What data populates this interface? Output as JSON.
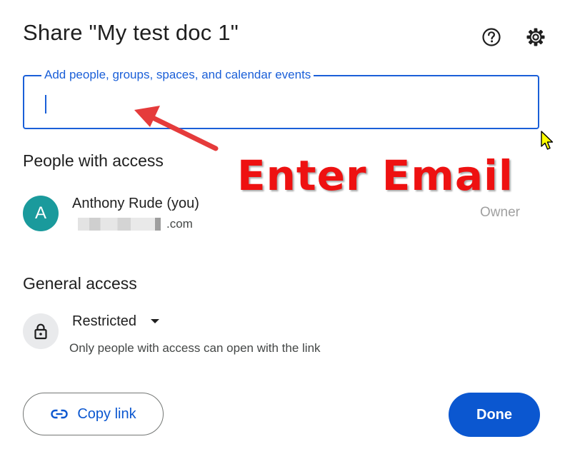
{
  "dialog": {
    "title": "Share \"My test doc 1\"",
    "help_icon": "help-circle-icon",
    "settings_icon": "gear-icon"
  },
  "add_people": {
    "label": "Add people, groups, spaces, and calendar events",
    "value": ""
  },
  "people_with_access": {
    "heading": "People with access",
    "people": [
      {
        "avatar_letter": "A",
        "avatar_color": "#1a9a9c",
        "name": "Anthony Rude (you)",
        "email_visible_suffix": ".com",
        "role": "Owner"
      }
    ]
  },
  "general_access": {
    "heading": "General access",
    "icon": "lock-icon",
    "selected": "Restricted",
    "description": "Only people with access can open with the link"
  },
  "buttons": {
    "copy_link": "Copy link",
    "copy_link_icon": "link-icon",
    "done": "Done"
  },
  "annotation": {
    "text": "Enter Email",
    "color": "#ee1111"
  },
  "colors": {
    "accent": "#0b57d0",
    "focus_border": "#1a5fd8"
  }
}
